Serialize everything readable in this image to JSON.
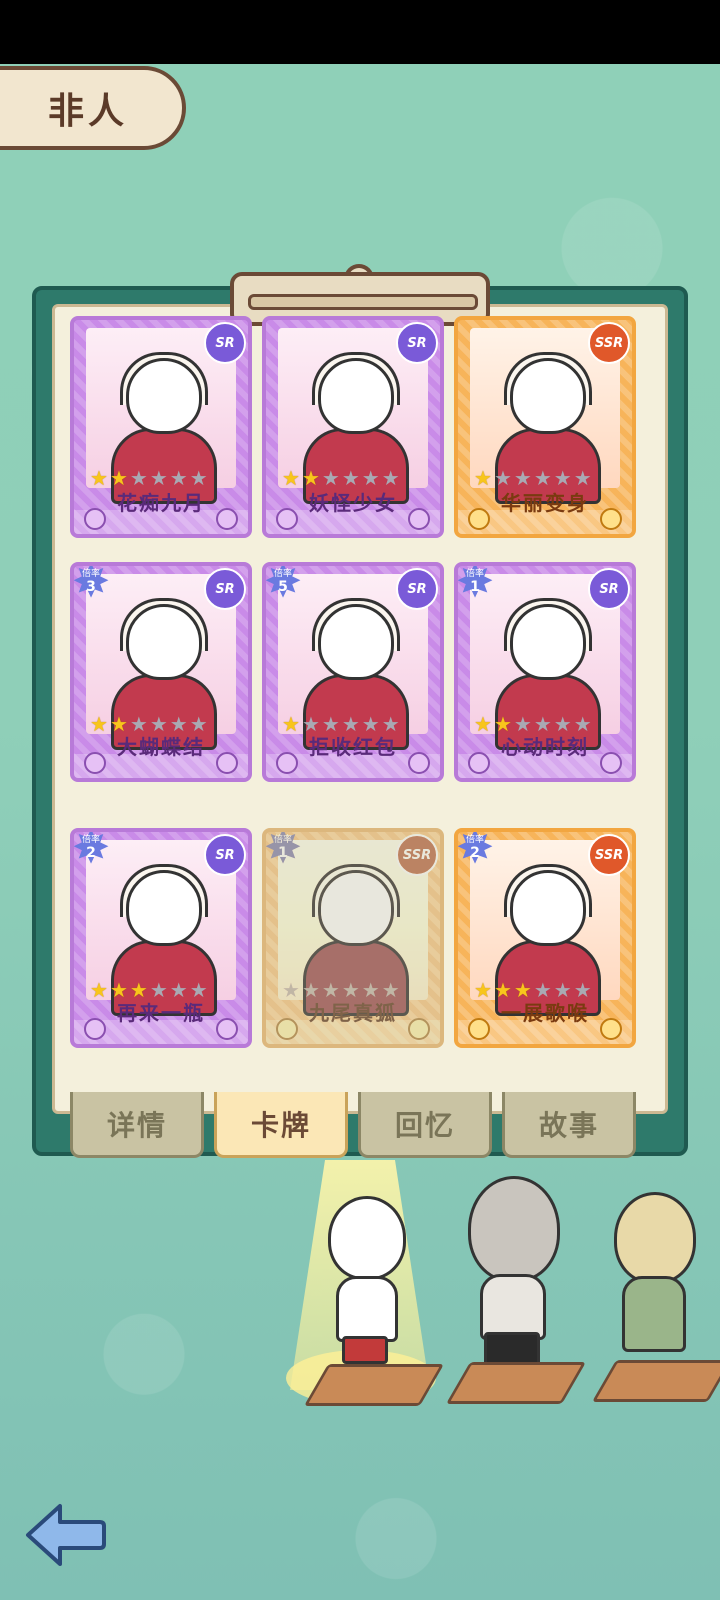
{
  "category_title": "非人",
  "cards": [
    {
      "name": "花痴九月",
      "rarity": "SR",
      "multiplier_label": "",
      "multiplier": "",
      "stars_filled": 2,
      "stars_total": 6,
      "frame": "purple",
      "locked": false
    },
    {
      "name": "妖怪少女",
      "rarity": "SR",
      "multiplier_label": "",
      "multiplier": "",
      "stars_filled": 2,
      "stars_total": 6,
      "frame": "purple",
      "locked": false
    },
    {
      "name": "华丽变身",
      "rarity": "SSR",
      "multiplier_label": "",
      "multiplier": "",
      "stars_filled": 1,
      "stars_total": 6,
      "frame": "gold",
      "locked": false
    },
    {
      "name": "大蝴蝶结",
      "rarity": "SR",
      "multiplier_label": "倍率",
      "multiplier": "3",
      "stars_filled": 2,
      "stars_total": 6,
      "frame": "purple",
      "locked": false
    },
    {
      "name": "拒收红包",
      "rarity": "SR",
      "multiplier_label": "倍率",
      "multiplier": "5",
      "stars_filled": 1,
      "stars_total": 6,
      "frame": "purple",
      "locked": false
    },
    {
      "name": "心动时刻",
      "rarity": "SR",
      "multiplier_label": "倍率",
      "multiplier": "1",
      "stars_filled": 2,
      "stars_total": 6,
      "frame": "purple",
      "locked": false
    },
    {
      "name": "再来一瓶",
      "rarity": "SR",
      "multiplier_label": "倍率",
      "multiplier": "2",
      "stars_filled": 3,
      "stars_total": 6,
      "frame": "purple",
      "locked": false
    },
    {
      "name": "九尾真狐",
      "rarity": "SSR",
      "multiplier_label": "倍率",
      "multiplier": "1",
      "stars_filled": 0,
      "stars_total": 6,
      "frame": "gold",
      "locked": true
    },
    {
      "name": "一展歌喉",
      "rarity": "SSR",
      "multiplier_label": "倍率",
      "multiplier": "2",
      "stars_filled": 3,
      "stars_total": 6,
      "frame": "gold",
      "locked": false
    }
  ],
  "tabs": [
    {
      "label": "详情",
      "active": false
    },
    {
      "label": "卡牌",
      "active": true
    },
    {
      "label": "回忆",
      "active": false
    },
    {
      "label": "故事",
      "active": false
    }
  ],
  "colors": {
    "background": "#8fd0b8",
    "board": "#2e7a6b",
    "card_purple": "#c98be8",
    "card_gold": "#f7b45a",
    "star_on": "#f8c51c",
    "star_off": "#a9a9b3",
    "tab_active": "#fbe7b6"
  },
  "icons": {
    "back": "back-arrow-icon"
  }
}
